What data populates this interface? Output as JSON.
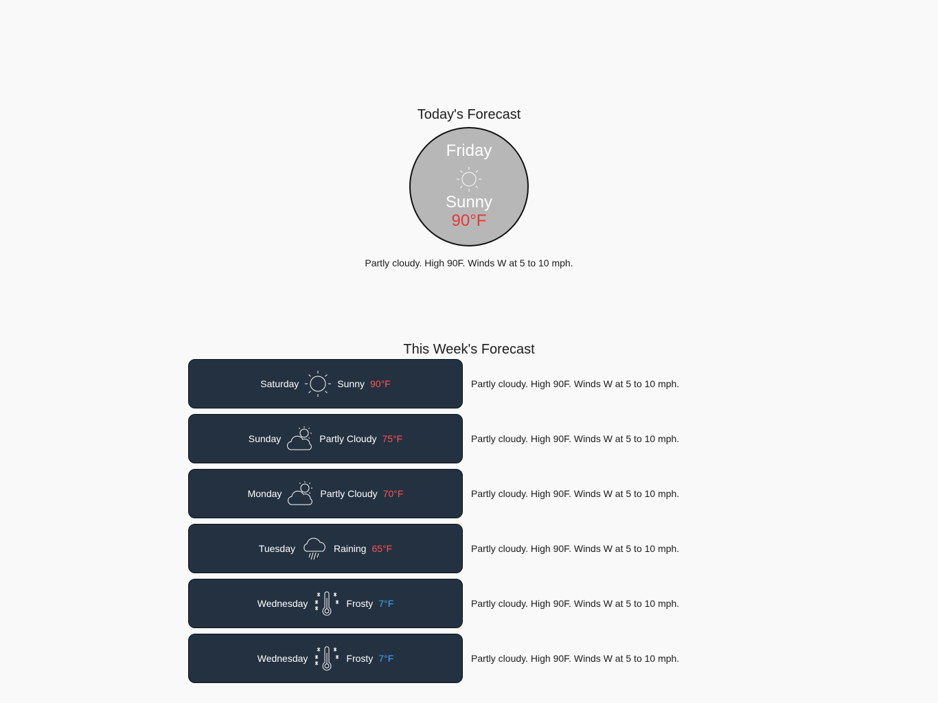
{
  "today": {
    "title": "Today's Forecast",
    "day": "Friday",
    "icon": "sun-icon",
    "condition": "Sunny",
    "temperature": "90°F",
    "description": "Partly cloudy. High 90F. Winds W at 5 to 10 mph."
  },
  "week": {
    "title": "This Week's Forecast",
    "days": [
      {
        "day": "Saturday",
        "icon": "sun-icon",
        "condition": "Sunny",
        "temperature": "90°F",
        "description": "Partly cloudy. High 90F. Winds W at 5 to 10 mph."
      },
      {
        "day": "Sunday",
        "icon": "partly-cloudy-icon",
        "condition": "Partly Cloudy",
        "temperature": "75°F",
        "description": "Partly cloudy. High 90F. Winds W at 5 to 10 mph."
      },
      {
        "day": "Monday",
        "icon": "partly-cloudy-icon",
        "condition": "Partly Cloudy",
        "temperature": "70°F",
        "description": "Partly cloudy. High 90F. Winds W at 5 to 10 mph."
      },
      {
        "day": "Tuesday",
        "icon": "rain-cloud-icon",
        "condition": "Raining",
        "temperature": "65°F",
        "description": "Partly cloudy. High 90F. Winds W at 5 to 10 mph."
      },
      {
        "day": "Wednesday",
        "icon": "frost-thermometer-icon",
        "condition": "Frosty",
        "temperature": "7°F",
        "description": "Partly cloudy. High 90F. Winds W at 5 to 10 mph."
      },
      {
        "day": "Wednesday",
        "icon": "frost-thermometer-icon",
        "condition": "Frosty",
        "temperature": "7°F",
        "description": "Partly cloudy. High 90F. Winds W at 5 to 10 mph."
      }
    ]
  },
  "colors": {
    "hot_temp": "#e53935",
    "cold_temp": "#42a5f5",
    "card_bg": "#243140",
    "circle_bg": "#b7b7b7"
  }
}
